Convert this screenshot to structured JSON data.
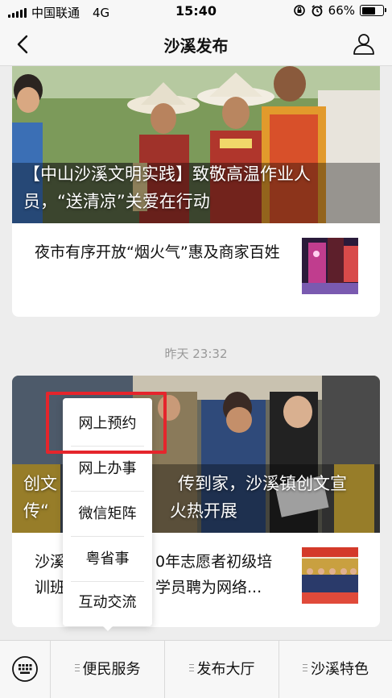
{
  "status_bar": {
    "carrier": "中国联通",
    "network": "4G",
    "time": "15:40",
    "battery": "66%",
    "battery_level": 0.66
  },
  "nav": {
    "title": "沙溪发布"
  },
  "feed": [
    {
      "headline": "【中山沙溪文明实践】致敬高温作业人员，“送清凉”关爱在行动",
      "sub_article": "夜市有序开放“烟火气”惠及商家百姓"
    },
    {
      "timestamp": "昨天 23:32",
      "headline_fragments": [
        "创文",
        "传到家，沙溪镇创文宣",
        "传“",
        "火热开展"
      ],
      "sub_fragments": [
        "沙溪",
        "0年志愿者初级培",
        "训班",
        "学员聘为网络..."
      ]
    }
  ],
  "popup_menu": {
    "items": [
      "网上预约",
      "网上办事",
      "微信矩阵",
      "粤省事",
      "互动交流"
    ]
  },
  "bottom_menu": {
    "items": [
      "便民服务",
      "发布大厅",
      "沙溪特色"
    ]
  },
  "colors": {
    "highlight": "#e5252c",
    "background": "#ededed",
    "bar": "#f7f7f7"
  },
  "icons": [
    "back-chevron-icon",
    "profile-icon",
    "keyboard-icon",
    "menu-lines-icon",
    "alarm-icon",
    "lock-rotation-icon"
  ]
}
